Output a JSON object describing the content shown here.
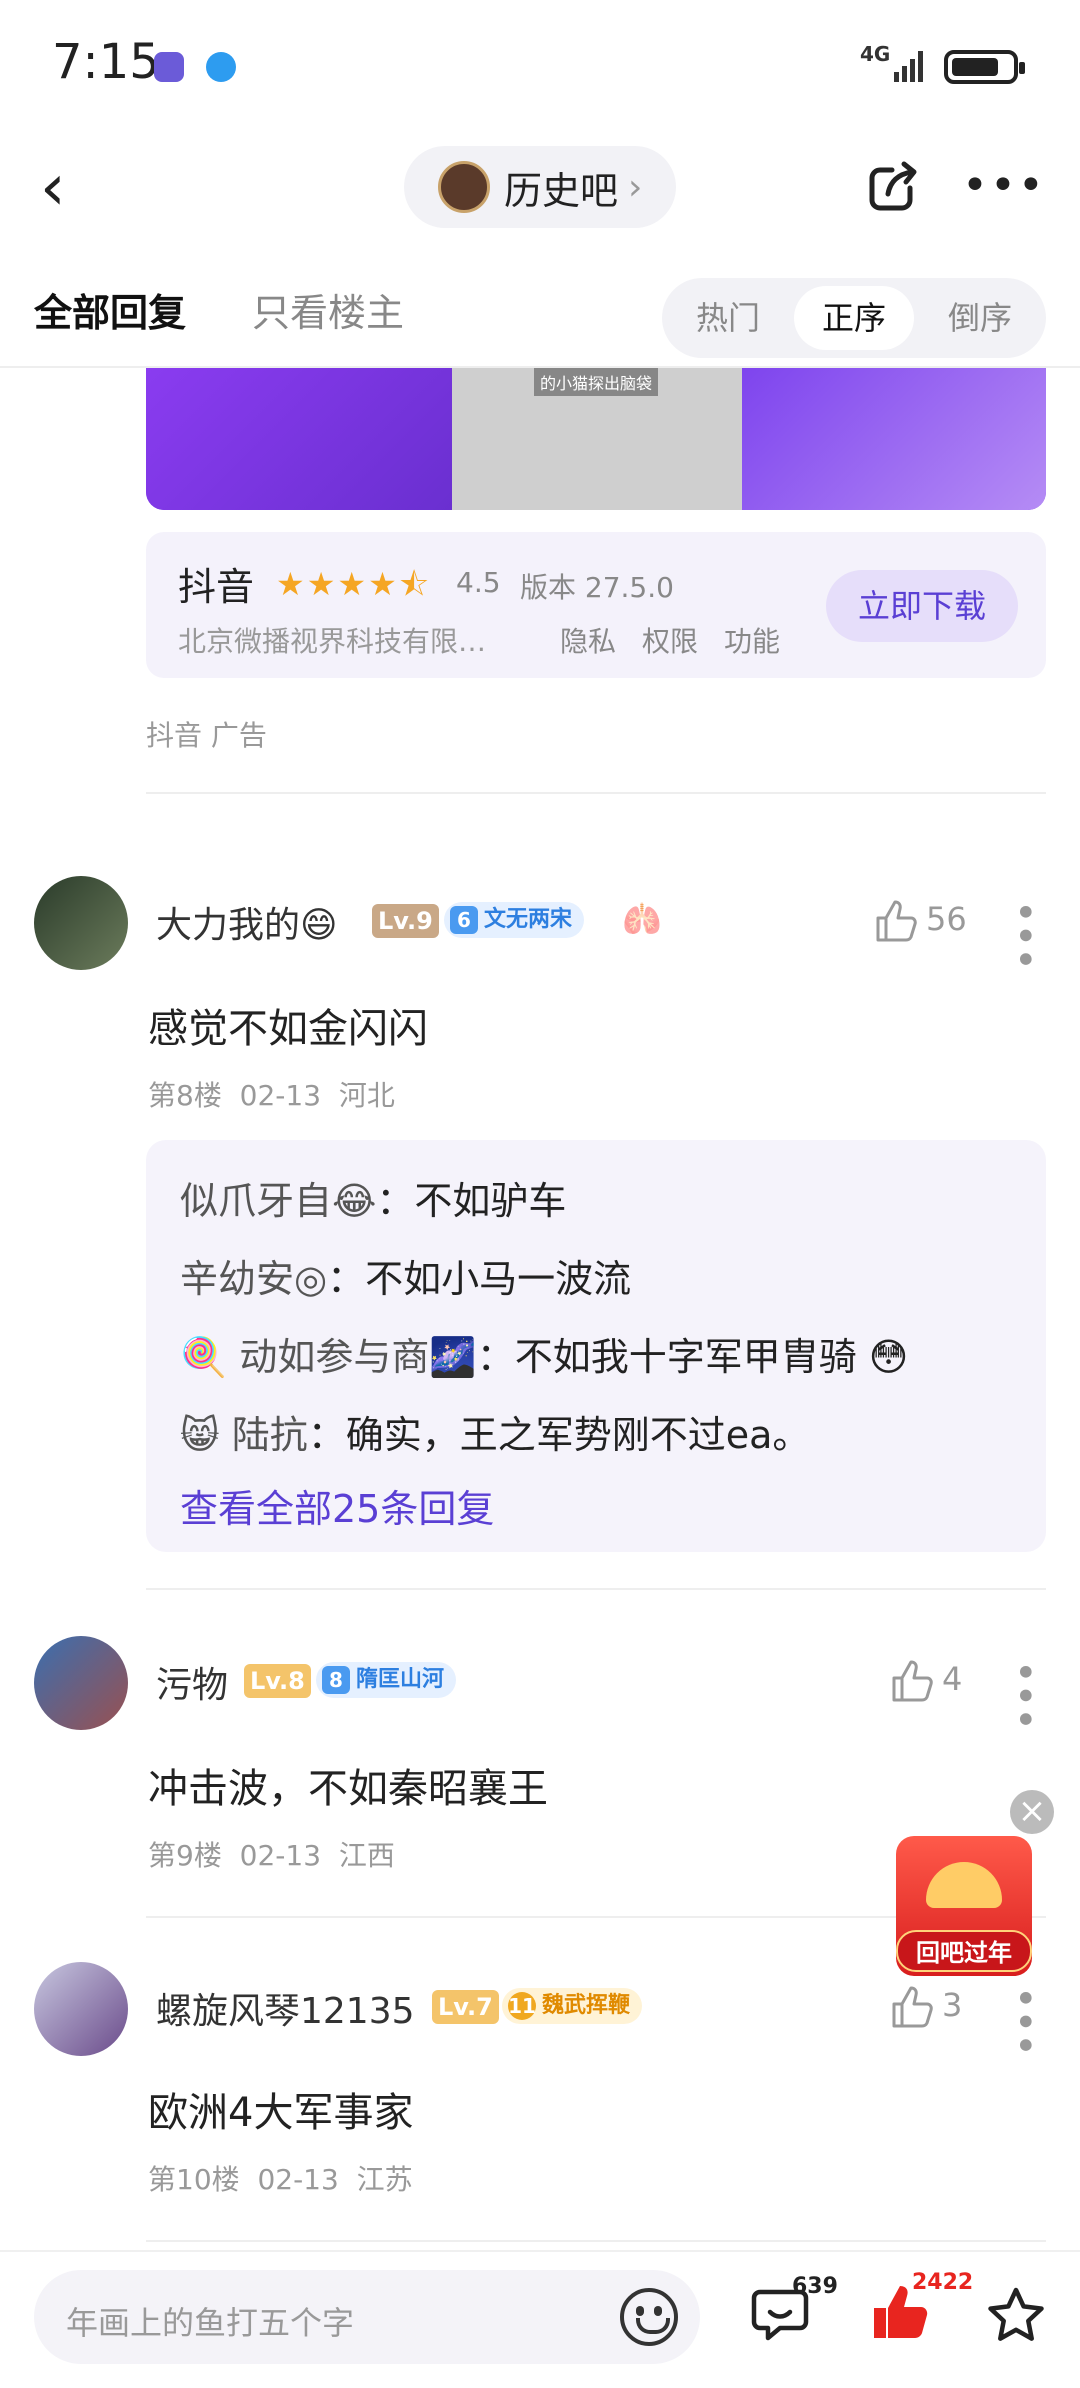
{
  "status_bar": {
    "time": "7:15",
    "network": "4G"
  },
  "nav": {
    "forum_name": "历史吧"
  },
  "tabs": {
    "all": "全部回复",
    "owner_only": "只看楼主"
  },
  "sort": {
    "hot": "热门",
    "asc": "正序",
    "desc": "倒序",
    "selected": "正序"
  },
  "ad": {
    "image_caption": "的小猫探出脑袋",
    "app_name": "抖音",
    "rating": "4.5",
    "version": "版本 27.5.0",
    "company": "北京微播视界科技有限…",
    "links": [
      "隐私",
      "权限",
      "功能"
    ],
    "download": "立即下载",
    "tag": "抖音  广告"
  },
  "comments": [
    {
      "user": "大力我的😄",
      "level": "Lv.9",
      "badge_num": "6",
      "badge_text": "文无两宋",
      "likes": "56",
      "text": "感觉不如金闪闪",
      "floor": "第8楼",
      "date": "02-13",
      "location": "河北",
      "replies": [
        {
          "name": "似爪牙自😂",
          "text": "：不如驴车"
        },
        {
          "name": "辛幼安◎",
          "text": "：不如小马一波流"
        },
        {
          "name": "🍭 动如参与商🌌",
          "text": "：不如我十字军甲胄骑 😳"
        },
        {
          "name": "😸 陆抗",
          "text": "：确实，王之军势刚不过ea。"
        }
      ],
      "view_all": "查看全部25条回复"
    },
    {
      "user": "污物",
      "level": "Lv.8",
      "badge_num": "8",
      "badge_text": "隋匡山河",
      "likes": "4",
      "text": "冲击波，不如秦昭襄王",
      "floor": "第9楼",
      "date": "02-13",
      "location": "江西"
    },
    {
      "user": "螺旋风琴12135",
      "level": "Lv.7",
      "badge_num": "11",
      "badge_text": "魏武挥鞭",
      "likes": "3",
      "text": "欧洲4大军事家",
      "floor": "第10楼",
      "date": "02-13",
      "location": "江苏"
    }
  ],
  "floating": {
    "redpacket": "回吧过年"
  },
  "bottom": {
    "placeholder": "年画上的鱼打五个字",
    "comment_count": "639",
    "like_count": "2422"
  },
  "colors": {
    "accent": "#5a3fd4",
    "like_red": "#e8251f"
  }
}
